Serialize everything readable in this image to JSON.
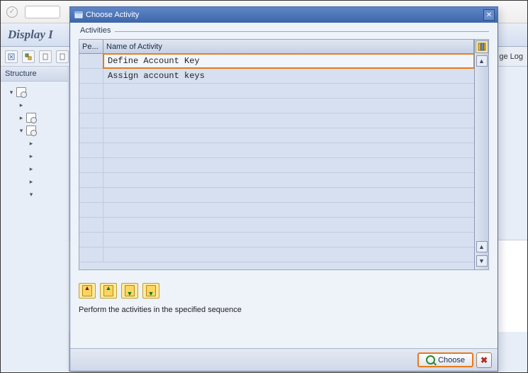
{
  "bg": {
    "title": "Display I",
    "structure_header": "Structure",
    "toolbar_items": [
      "",
      "",
      "",
      ""
    ],
    "change_log_label": "ge Log"
  },
  "dialog": {
    "title": "Choose Activity",
    "group_label": "Activities",
    "columns": {
      "perform": "Pe...",
      "name": "Name of Activity"
    },
    "activities": [
      {
        "name": "Define Account Key",
        "selected": true
      },
      {
        "name": "Assign account keys",
        "selected": false
      }
    ],
    "instruction": "Perform the activities in the specified sequence",
    "buttons": {
      "choose": "Choose",
      "cancel": "✖"
    }
  }
}
